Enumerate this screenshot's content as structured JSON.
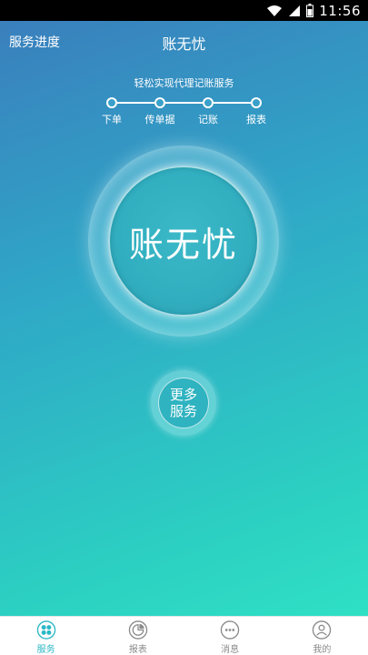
{
  "status_bar": {
    "time": "11:56",
    "icons": [
      "wifi-icon",
      "signal-icon",
      "battery-icon"
    ]
  },
  "header": {
    "left_link": "服务进度",
    "title": "账无忧"
  },
  "slogan": "轻松实现代理记账服务",
  "steps": [
    {
      "label": "下单"
    },
    {
      "label": "传单据"
    },
    {
      "label": "记账"
    },
    {
      "label": "报表"
    }
  ],
  "main_button": {
    "label": "账无忧"
  },
  "more_button": {
    "line1": "更多",
    "line2": "服务"
  },
  "tabbar": [
    {
      "label": "服务",
      "icon": "grid-icon",
      "active": true
    },
    {
      "label": "报表",
      "icon": "chart-icon",
      "active": false
    },
    {
      "label": "消息",
      "icon": "message-icon",
      "active": false
    },
    {
      "label": "我的",
      "icon": "user-icon",
      "active": false
    }
  ],
  "colors": {
    "accent": "#2bb7c6",
    "gradient_top": "#3a7fbd",
    "gradient_bottom": "#2fe0c4"
  }
}
